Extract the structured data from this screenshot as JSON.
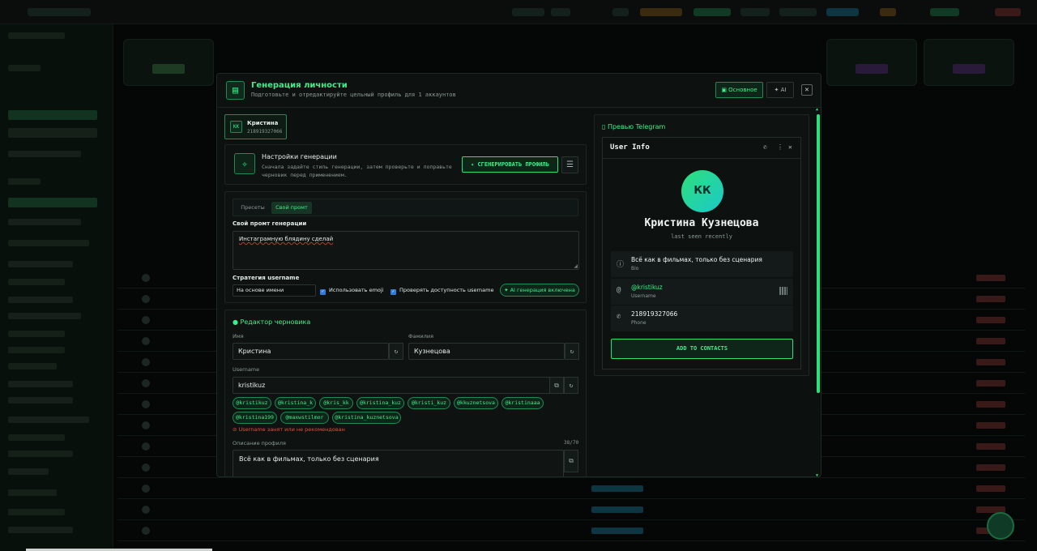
{
  "modal": {
    "title": "Генерация личности",
    "subtitle": "Подготовьте и отредактируйте цельный профиль для 1 аккаунтов",
    "tab_basic": "Основное",
    "tab_ai": "AI",
    "close": "✕"
  },
  "account": {
    "initials": "КК",
    "name": "Кристина",
    "id": "218919327066"
  },
  "generation": {
    "title": "Настройки генерации",
    "description": "Сначала задайте стиль генерации, затем проверьте и поправьте черновик перед применением.",
    "generate_button": "СГЕНЕРИРОВАТЬ ПРОФИЛЬ"
  },
  "prompt": {
    "tabs": [
      "Пресеты",
      "Свой промт"
    ],
    "label": "Свой промт генерации",
    "value": "Инстаграмную блядину сделай",
    "strategy_label": "Стратегия username",
    "strategy_value": "На основе имени",
    "use_emoji": "Использовать emoji",
    "check_username": "Проверять доступность username",
    "ai_badge": "AI генерация включена"
  },
  "draft": {
    "title": "Редактор черновика",
    "first_name_label": "Имя",
    "first_name": "Кристина",
    "last_name_label": "Фамилия",
    "last_name": "Кузнецова",
    "username_label": "Username",
    "username": "kristikuz",
    "suggestions": [
      "@kristikuz",
      "@kristina_k",
      "@kris_kk",
      "@kristina_kuz",
      "@kristi_kuz",
      "@kkuznetsova",
      "@kristinaaa",
      "@kristina199",
      "@maxwstilmor",
      "@kristina_kuznetsova"
    ],
    "warning": "Username занят или не рекомендован",
    "bio_label": "Описание профиля",
    "bio_count": "38/70",
    "bio": "Всё как в фильмах, только без сценария"
  },
  "preview": {
    "title": "Превью Telegram",
    "header": "User Info",
    "initials": "КК",
    "name": "Кристина Кузнецова",
    "status": "last seen recently",
    "bio": "Всё как в фильмах, только без сценария",
    "bio_label": "Bio",
    "username": "@kristikuz",
    "username_label": "Username",
    "phone": "218919327066",
    "phone_label": "Phone",
    "add_button": "ADD TO CONTACTS"
  },
  "colors": {
    "accent": "#2ee07a",
    "danger": "#e74c3c",
    "background": "#0c100f"
  }
}
